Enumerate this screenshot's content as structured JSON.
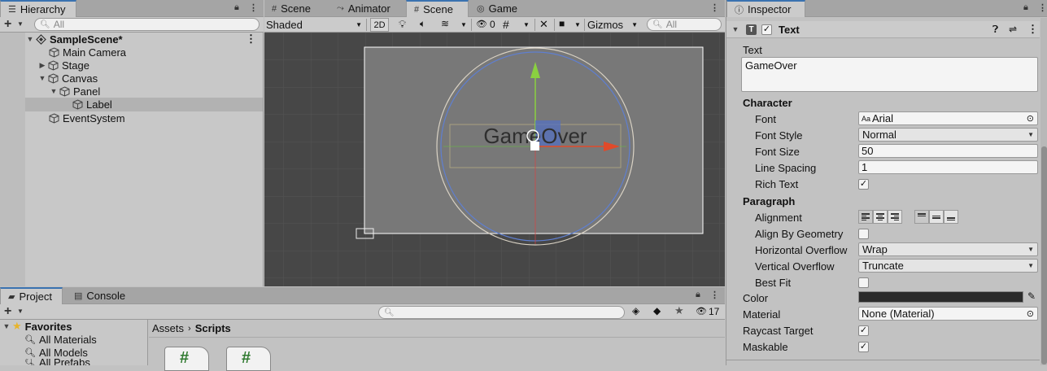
{
  "hierarchy": {
    "tab_label": "Hierarchy",
    "search_placeholder": "All",
    "scene_name": "SampleScene*",
    "items": [
      {
        "label": "Main Camera"
      },
      {
        "label": "Stage"
      },
      {
        "label": "Canvas"
      },
      {
        "label": "Panel"
      },
      {
        "label": "Label"
      },
      {
        "label": "EventSystem"
      }
    ]
  },
  "scene_tabs": {
    "tab1": "Scene",
    "tab2": "Animator",
    "tab3": "Scene",
    "tab4": "Game"
  },
  "scene_toolbar": {
    "shading": "Shaded",
    "mode_2d": "2D",
    "hidden_count": "0",
    "gizmos": "Gizmos",
    "search_placeholder": "All"
  },
  "scene_view": {
    "text": "GameOver"
  },
  "project": {
    "tab_project": "Project",
    "tab_console": "Console",
    "favorites": "Favorites",
    "fav_items": [
      "All Materials",
      "All Models",
      "All Prefabs"
    ],
    "breadcrumb_root": "Assets",
    "breadcrumb_current": "Scripts",
    "hidden_count": "17"
  },
  "inspector": {
    "tab_label": "Inspector",
    "component_title": "Text",
    "text_label": "Text",
    "text_value": "GameOver",
    "character_header": "Character",
    "font_label": "Font",
    "font_value": "Arial",
    "font_style_label": "Font Style",
    "font_style_value": "Normal",
    "font_size_label": "Font Size",
    "font_size_value": "50",
    "line_spacing_label": "Line Spacing",
    "line_spacing_value": "1",
    "rich_text_label": "Rich Text",
    "paragraph_header": "Paragraph",
    "alignment_label": "Alignment",
    "align_geom_label": "Align By Geometry",
    "h_overflow_label": "Horizontal Overflow",
    "h_overflow_value": "Wrap",
    "v_overflow_label": "Vertical Overflow",
    "v_overflow_value": "Truncate",
    "best_fit_label": "Best Fit",
    "color_label": "Color",
    "color_value": "#2b2b2b",
    "material_label": "Material",
    "material_value": "None (Material)",
    "raycast_label": "Raycast Target",
    "maskable_label": "Maskable"
  }
}
